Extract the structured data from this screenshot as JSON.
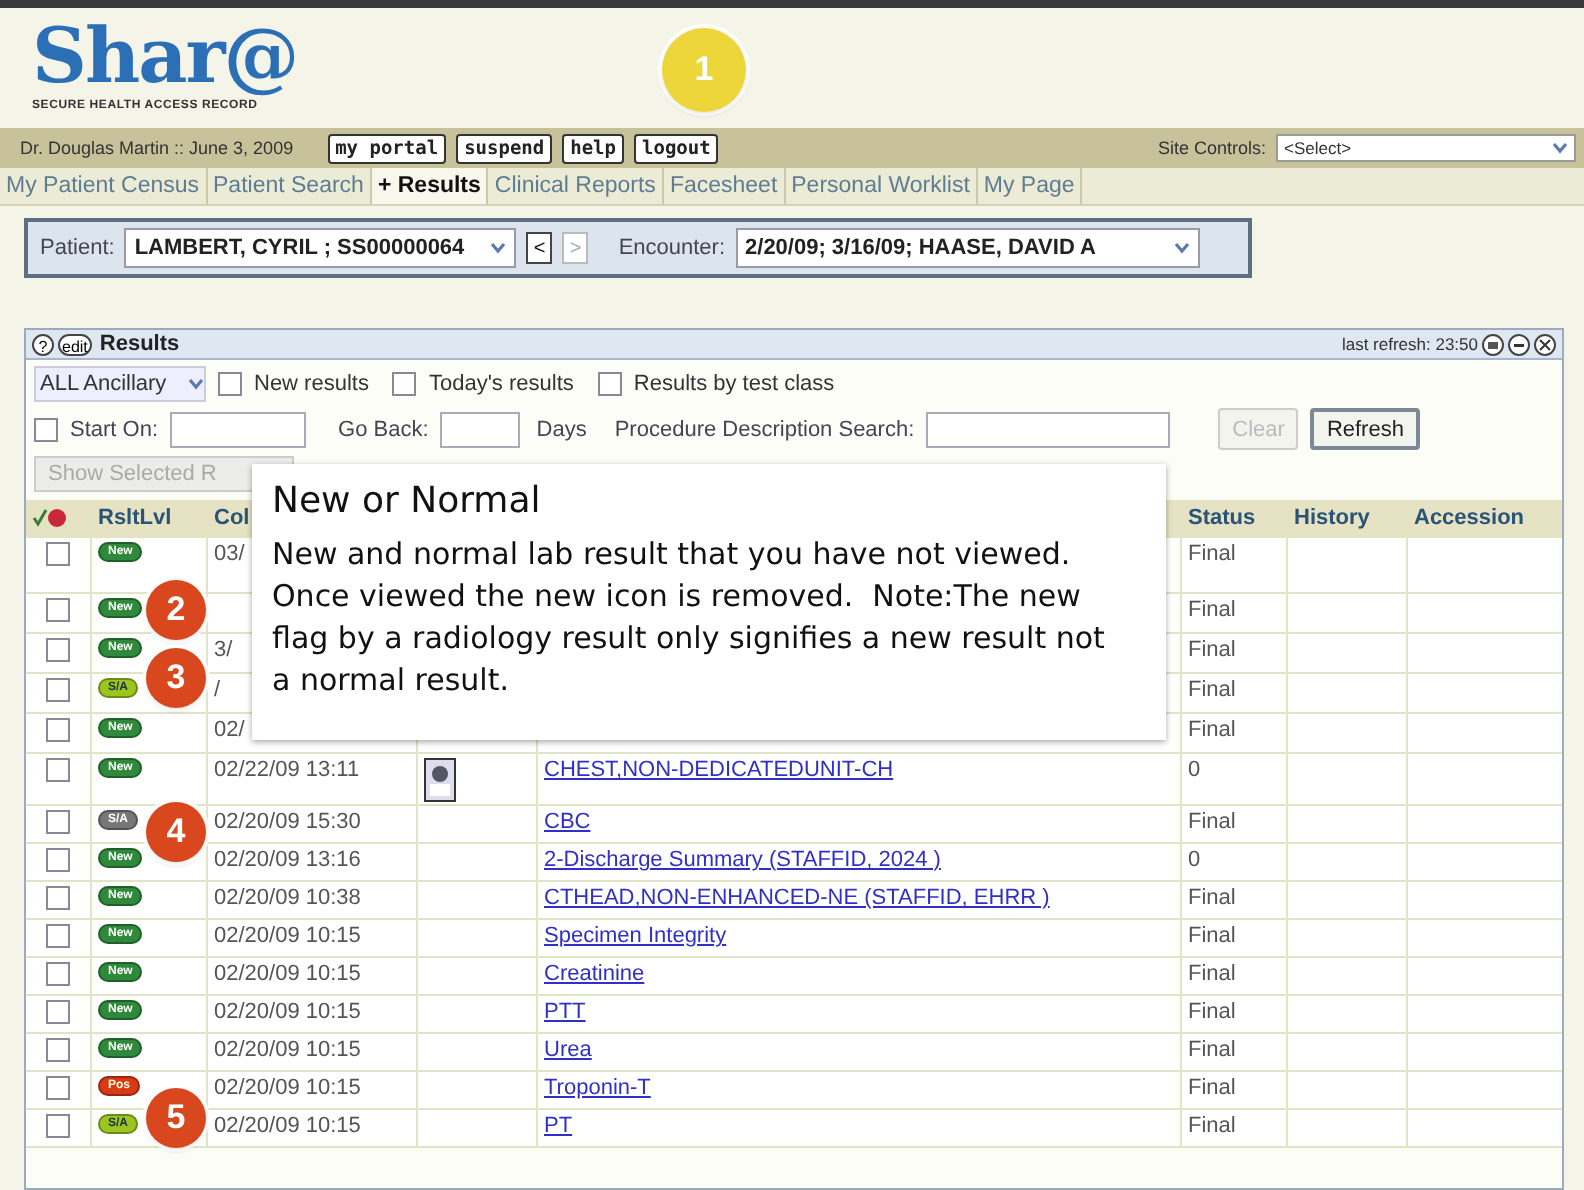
{
  "logo": {
    "name": "Shar@",
    "tagline": "SECURE HEALTH ACCESS RECORD"
  },
  "toolbar": {
    "user": "Dr. Douglas Martin :: June 3, 2009",
    "buttons": [
      "my portal",
      "suspend",
      "help",
      "logout"
    ],
    "site_controls": {
      "label": "Site Controls:",
      "value": "<Select>"
    }
  },
  "tabs": [
    {
      "label": "My Patient Census",
      "selected": false
    },
    {
      "label": "Patient Search",
      "selected": false
    },
    {
      "label": "+ Results",
      "selected": true
    },
    {
      "label": "Clinical Reports",
      "selected": false
    },
    {
      "label": "Facesheet",
      "selected": false
    },
    {
      "label": "Personal Worklist",
      "selected": false
    },
    {
      "label": "My Page",
      "selected": false
    }
  ],
  "patient_bar": {
    "patient_label": "Patient:",
    "patient": "LAMBERT, CYRIL ; SS00000064",
    "prev": "<",
    "next": ">",
    "encounter_label": "Encounter:",
    "encounter": "2/20/09; 3/16/09; HAASE, DAVID A"
  },
  "results": {
    "help": "?",
    "edit": "edit",
    "title": "Results",
    "last_refresh": "last refresh: 23:50",
    "filter": {
      "value": "ALL Ancillary"
    },
    "checkboxes": [
      {
        "label": "New results",
        "checked": false
      },
      {
        "label": "Today's results",
        "checked": false
      },
      {
        "label": "Results by test class",
        "checked": false
      }
    ],
    "start_on": {
      "label": "Start On:",
      "checked": false
    },
    "go_back": "Go Back:",
    "days": "Days",
    "search_label": "Procedure Description Search:",
    "buttons": [
      {
        "label": "Clear",
        "disabled": true
      },
      {
        "label": "Refresh",
        "disabled": false
      }
    ],
    "show_selected": {
      "label": "Show Selected R",
      "disabled": true
    },
    "columns": [
      "RsltLvl",
      "Col",
      "Status",
      "History",
      "Accession"
    ],
    "rows": [
      {
        "checked": false,
        "badge": {
          "kind": "new",
          "label": "New"
        },
        "date": "03/",
        "status": "Final"
      },
      {
        "checked": false,
        "badge": {
          "kind": "new",
          "label": "New"
        },
        "status": "Final"
      },
      {
        "checked": false,
        "badge": {
          "kind": "new",
          "label": "New"
        },
        "date": "3/",
        "status": "Final"
      },
      {
        "checked": false,
        "badge": {
          "kind": "sfa",
          "label": "S/A"
        },
        "date": "/",
        "status": "Final"
      },
      {
        "checked": false,
        "badge": {
          "kind": "new",
          "label": "New"
        },
        "date": "02/",
        "status": "Final"
      },
      {
        "checked": false,
        "badge": {
          "kind": "new",
          "label": "New"
        },
        "date": "02/22/09 13:11",
        "image": true,
        "procedure": "CHEST,NON-DEDICATEDUNIT-CH",
        "status": "0"
      },
      {
        "checked": false,
        "badge": {
          "kind": "sfa_gray",
          "label": "S/A"
        },
        "date": "02/20/09 15:30",
        "procedure": "CBC",
        "status": "Final"
      },
      {
        "checked": false,
        "badge": {
          "kind": "new",
          "label": "New"
        },
        "date": "02/20/09 13:16",
        "procedure": "2-Discharge Summary (STAFFID, 2024 )",
        "status": "0"
      },
      {
        "checked": false,
        "badge": {
          "kind": "new",
          "label": "New"
        },
        "date": "02/20/09 10:38",
        "procedure": "CTHEAD,NON-ENHANCED-NE (STAFFID, EHRR )",
        "status": "Final"
      },
      {
        "checked": false,
        "badge": {
          "kind": "new",
          "label": "New"
        },
        "date": "02/20/09 10:15",
        "procedure": "Specimen Integrity",
        "status": "Final"
      },
      {
        "checked": false,
        "badge": {
          "kind": "new",
          "label": "New"
        },
        "date": "02/20/09 10:15",
        "procedure": "Creatinine",
        "status": "Final"
      },
      {
        "checked": false,
        "badge": {
          "kind": "new",
          "label": "New"
        },
        "date": "02/20/09 10:15",
        "procedure": "PTT",
        "status": "Final"
      },
      {
        "checked": false,
        "badge": {
          "kind": "new",
          "label": "New"
        },
        "date": "02/20/09 10:15",
        "procedure": "Urea",
        "status": "Final"
      },
      {
        "checked": false,
        "badge": {
          "kind": "pos",
          "label": "Pos"
        },
        "date": "02/20/09 10:15",
        "procedure": "Troponin-T",
        "status": "Final"
      },
      {
        "checked": false,
        "badge": {
          "kind": "sfa",
          "label": "S/A"
        },
        "date": "02/20/09 10:15",
        "procedure": "PT",
        "status": "Final"
      }
    ]
  },
  "tooltip": {
    "title": "New or Normal",
    "body": "New and normal lab result that you have not viewed.\nOnce viewed the new icon is removed.  Note:The new\nflag by a radiology result only signifies a new result not\na normal result."
  },
  "callouts": [
    {
      "number": "1",
      "color": "#ecd63a"
    },
    {
      "number": "2",
      "color": "#d8471d"
    },
    {
      "number": "3",
      "color": "#d8471d"
    },
    {
      "number": "4",
      "color": "#d8471d"
    },
    {
      "number": "5",
      "color": "#d8471d"
    }
  ]
}
